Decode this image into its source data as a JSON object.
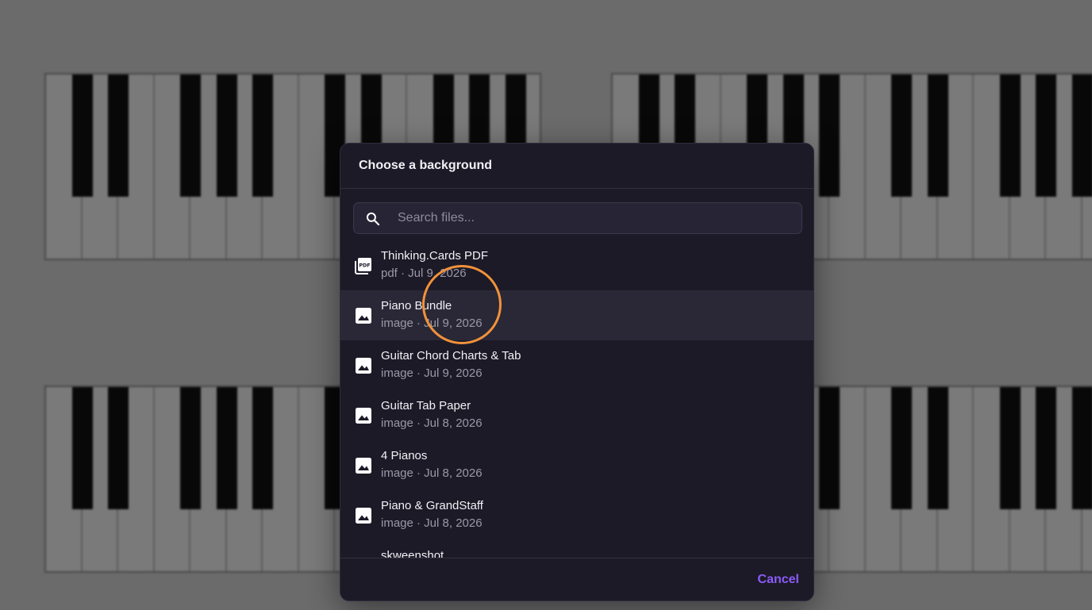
{
  "dialog": {
    "title": "Choose a background",
    "search": {
      "placeholder": "Search files...",
      "value": ""
    },
    "files": [
      {
        "name": "Thinking.Cards PDF",
        "meta": "pdf · Jul 9, 2026",
        "icon": "pdf-icon",
        "selected": false
      },
      {
        "name": "Piano Bundle",
        "meta": "image · Jul 9, 2026",
        "icon": "image-icon",
        "selected": true
      },
      {
        "name": "Guitar Chord Charts & Tab",
        "meta": "image · Jul 9, 2026",
        "icon": "image-icon",
        "selected": false
      },
      {
        "name": "Guitar Tab Paper",
        "meta": "image · Jul 8, 2026",
        "icon": "image-icon",
        "selected": false
      },
      {
        "name": "4 Pianos",
        "meta": "image · Jul 8, 2026",
        "icon": "image-icon",
        "selected": false
      },
      {
        "name": "Piano & GrandStaff",
        "meta": "image · Jul 8, 2026",
        "icon": "image-icon",
        "selected": false
      },
      {
        "name": "skweenshot",
        "meta": "",
        "icon": "image-icon",
        "selected": false
      }
    ],
    "cancel_label": "Cancel"
  },
  "colors": {
    "accent": "#8b5cf6",
    "dialog_bg": "#1c1a27",
    "selected_row": "#2a2836",
    "click_indicator": "#f2923a"
  }
}
